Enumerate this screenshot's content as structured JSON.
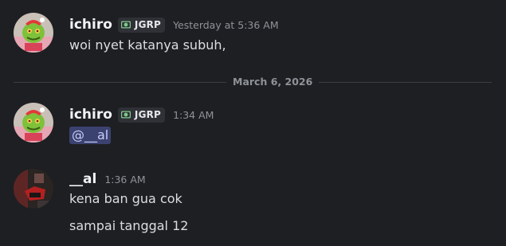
{
  "messages": [
    {
      "author": "ichiro",
      "tag": "JGRP",
      "timestamp": "Yesterday at 5:36 AM",
      "lines": [
        "woi nyet katanya subuh,"
      ]
    },
    {
      "author": "ichiro",
      "tag": "JGRP",
      "timestamp": "1:34 AM",
      "mention": "@__al"
    },
    {
      "author": "__al",
      "timestamp": "1:36 AM",
      "lines": [
        "kena ban gua cok",
        "sampai tanggal 12"
      ]
    }
  ],
  "date_divider": "March 6, 2026",
  "colors": {
    "background": "#1e1f23",
    "mention_bg": "#3c4270",
    "mention_text": "#c9cdfb",
    "tag_bg": "#2f3137"
  },
  "icons": {
    "tag_icon": "money-bill-icon"
  }
}
